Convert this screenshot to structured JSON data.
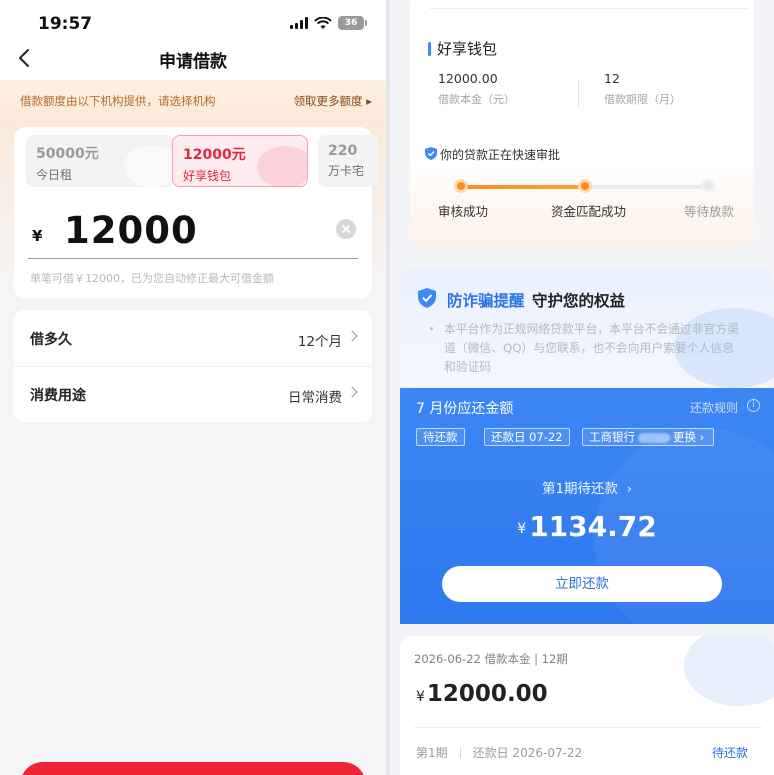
{
  "left": {
    "status": {
      "time": "19:57",
      "battery": "36"
    },
    "nav": {
      "title": "申请借款"
    },
    "notice": {
      "text": "借款额度由以下机构提供，请选择机构",
      "link": "领取更多额度 ▸"
    },
    "institutions": [
      {
        "amount": "50000元",
        "name": "今日租",
        "selected": false
      },
      {
        "amount": "12000元",
        "name": "好享钱包",
        "selected": true
      },
      {
        "amount": "220",
        "name": "万卡宅",
        "selected": false
      }
    ],
    "amount": {
      "symbol": "¥",
      "value": "12000",
      "hint": "单笔可借￥12000，已为您自动修正最大可借金额"
    },
    "options": [
      {
        "label": "借多久",
        "value": "12个月"
      },
      {
        "label": "消费用途",
        "value": "日常消费"
      }
    ]
  },
  "right": {
    "product": {
      "name": "好享钱包",
      "principal_value": "12000.00",
      "principal_label": "借款本金（元）",
      "term_value": "12",
      "term_label": "借款期限（月）"
    },
    "approval": {
      "title": "你的贷款正在快速审批",
      "steps": [
        {
          "label": "审核成功",
          "done": true
        },
        {
          "label": "资金匹配成功",
          "done": true
        },
        {
          "label": "等待放款",
          "done": false
        }
      ],
      "progress": 0.5
    },
    "fraud": {
      "title": "防诈骗提醒",
      "subtitle": "守护您的权益",
      "body": "本平台作为正规网络贷款平台，本平台不会通过非官方渠道（微信、QQ）与您联系，也不会向用户索要个人信息和验证码"
    },
    "bill": {
      "title": "7 月份应还金额",
      "rules": "还款规则",
      "tags": {
        "status": "待还款",
        "due": "还款日 07-22",
        "bank": "工商银行",
        "change": "更换 ›"
      },
      "period_title": "第1期待还款",
      "period_arrow": "›",
      "amount_symbol": "¥",
      "amount": "1134.72",
      "button": "立即还款"
    },
    "loan": {
      "meta": "2026-06-22    借款本金 | 12期",
      "symbol": "¥",
      "principal": "12000.00",
      "period": "第1期",
      "due_date": "还款日 2026-07-22",
      "status": "待还款"
    }
  },
  "colors": {
    "brand_red": "#ee2336",
    "brand_blue": "#2f78ee",
    "progress_orange": "#ff8a1f"
  }
}
